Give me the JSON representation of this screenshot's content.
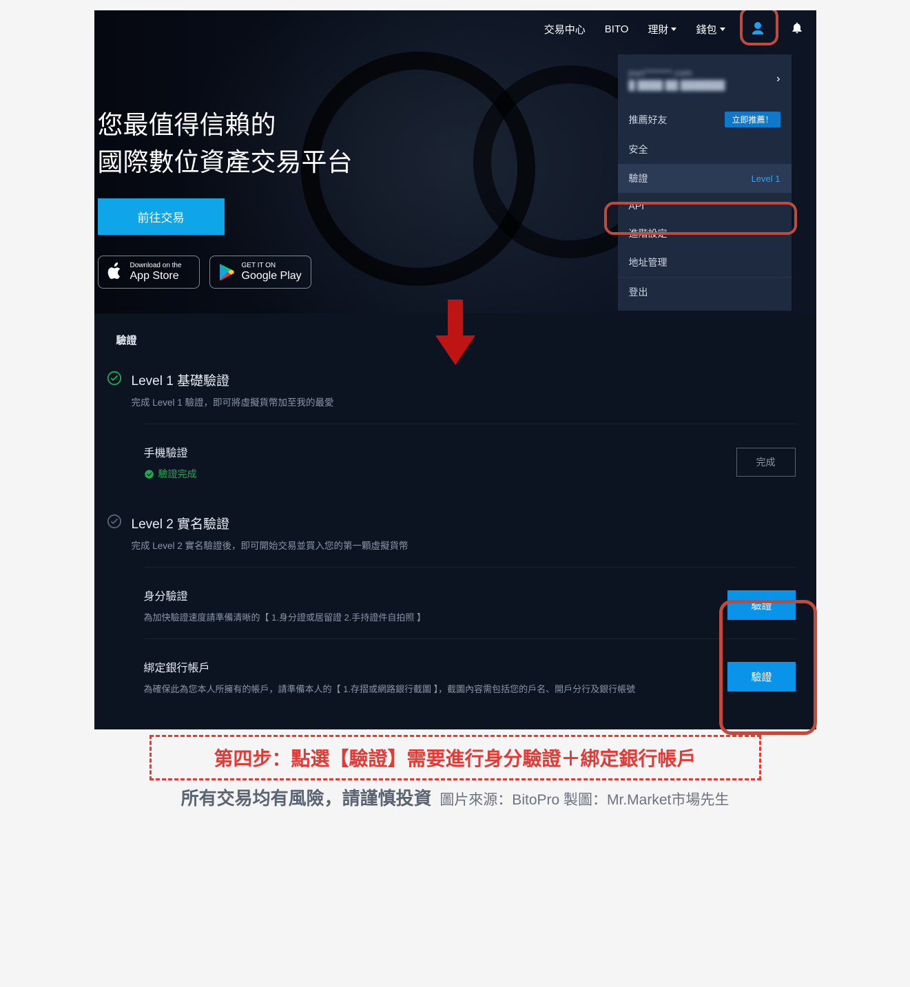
{
  "nav": {
    "trade": "交易中心",
    "bito": "BITO",
    "wealth": "理財",
    "wallet": "錢包"
  },
  "hero": {
    "line1": "您最值得信賴的",
    "line2": "國際數位資產交易平台",
    "cta": "前往交易",
    "appstore_small": "Download on the",
    "appstore_big": "App Store",
    "gplay_small": "GET IT ON",
    "gplay_big": "Google Play"
  },
  "dd": {
    "user_line1": "joys********.com",
    "user_line2": "█ ████ ██ ███████",
    "referral": "推薦好友",
    "referral_badge": "立即推薦！",
    "security": "安全",
    "verify": "驗證",
    "verify_level": "Level 1",
    "api": "API",
    "advanced": "進階設定",
    "address": "地址管理",
    "logout": "登出"
  },
  "panel": {
    "heading": "驗證",
    "lvl1_title": "Level 1 基礎驗證",
    "lvl1_desc": "完成 Level 1 驗證，即可將虛擬貨幣加至我的最愛",
    "phone_title": "手機驗證",
    "phone_done": "驗證完成",
    "btn_done": "完成",
    "lvl2_title": "Level 2 實名驗證",
    "lvl2_desc": "完成 Level 2 實名驗證後，即可開始交易並買入您的第一顆虛擬貨幣",
    "id_title": "身分驗證",
    "id_sub": "為加快驗證速度請準備清晰的【 1.身分證或居留證 2.手持證件自拍照 】",
    "bank_title": "綁定銀行帳戶",
    "bank_sub": "為確保此為您本人所擁有的帳戶，請準備本人的【 1.存摺或網路銀行截圖 】，截圖內容需包括您的戶名、開戶分行及銀行帳號",
    "btn_verify": "驗證"
  },
  "footer": {
    "step": "第四步：點選【驗證】需要進行身分驗證＋綁定銀行帳戶",
    "risk": "所有交易均有風險，請謹慎投資",
    "credit": "圖片來源：BitoPro  製圖：Mr.Market市場先生"
  }
}
